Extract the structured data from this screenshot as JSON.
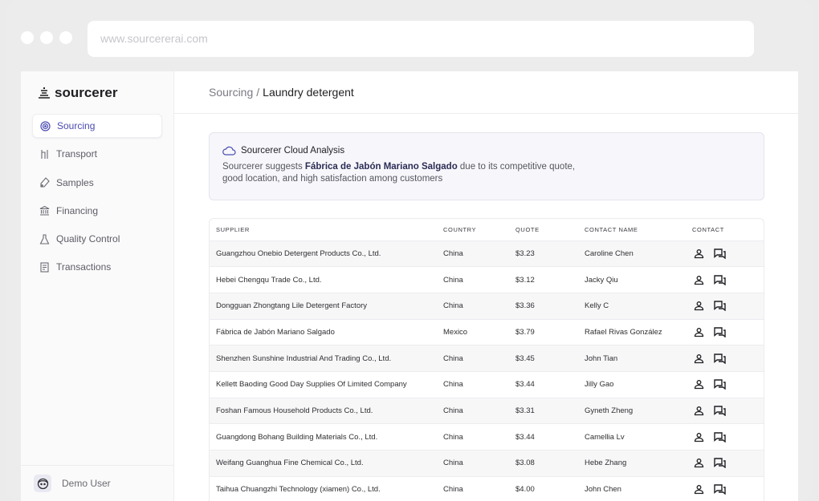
{
  "browser": {
    "url": "www.sourcererai.com"
  },
  "app": {
    "name": "sourcerer"
  },
  "sidebar": {
    "items": [
      {
        "label": "Sourcing",
        "icon": "target-icon",
        "active": true
      },
      {
        "label": "Transport",
        "icon": "route-icon"
      },
      {
        "label": "Samples",
        "icon": "samples-icon"
      },
      {
        "label": "Financing",
        "icon": "bank-icon"
      },
      {
        "label": "Quality Control",
        "icon": "flask-icon"
      },
      {
        "label": "Transactions",
        "icon": "receipt-icon"
      }
    ],
    "user": {
      "name": "Demo User"
    }
  },
  "header": {
    "breadcrumb_root": "Sourcing",
    "separator": "/",
    "page": "Laundry detergent"
  },
  "analysis": {
    "title": "Sourcerer Cloud Analysis",
    "text_before": "Sourcerer suggests ",
    "highlight": "Fábrica de Jabón Mariano Salgado",
    "text_after": " due to its competitive quote, good location, and high satisfaction among customers"
  },
  "table": {
    "headers": [
      "SUPPLIER",
      "COUNTRY",
      "QUOTE",
      "CONTACT NAME",
      "CONTACT"
    ],
    "rows": [
      [
        "Guangzhou Onebio Detergent Products Co., Ltd.",
        "China",
        "$3.23",
        "Caroline Chen"
      ],
      [
        "Hebei Chengqu Trade Co., Ltd.",
        "China",
        "$3.12",
        "Jacky Qiu"
      ],
      [
        "Dongguan Zhongtang Lile Detergent Factory",
        "China",
        "$3.36",
        "Kelly C"
      ],
      [
        "Fábrica de Jabón Mariano Salgado",
        "Mexico",
        "$3.79",
        "Rafael Rivas González"
      ],
      [
        "Shenzhen Sunshine Industrial And Trading Co., Ltd.",
        "China",
        "$3.45",
        "John Tian"
      ],
      [
        "Kellett Baoding Good Day Supplies Of Limited Company",
        "China",
        "$3.44",
        "Jilly Gao"
      ],
      [
        "Foshan Famous Household Products Co., Ltd.",
        "China",
        "$3.31",
        "Gyneth Zheng"
      ],
      [
        "Guangdong Bohang Building Materials Co., Ltd.",
        "China",
        "$3.44",
        "Camellia Lv"
      ],
      [
        "Weifang Guanghua Fine Chemical Co., Ltd.",
        "China",
        "$3.08",
        "Hebe Zhang"
      ],
      [
        "Taihua Chuangzhi Technology (xiamen) Co., Ltd.",
        "China",
        "$4.00",
        "John Chen"
      ]
    ]
  },
  "colors": {
    "accent": "#4a4bb0",
    "highlight_text": "#2c2c55",
    "panel_bg": "#f7f7fb"
  }
}
